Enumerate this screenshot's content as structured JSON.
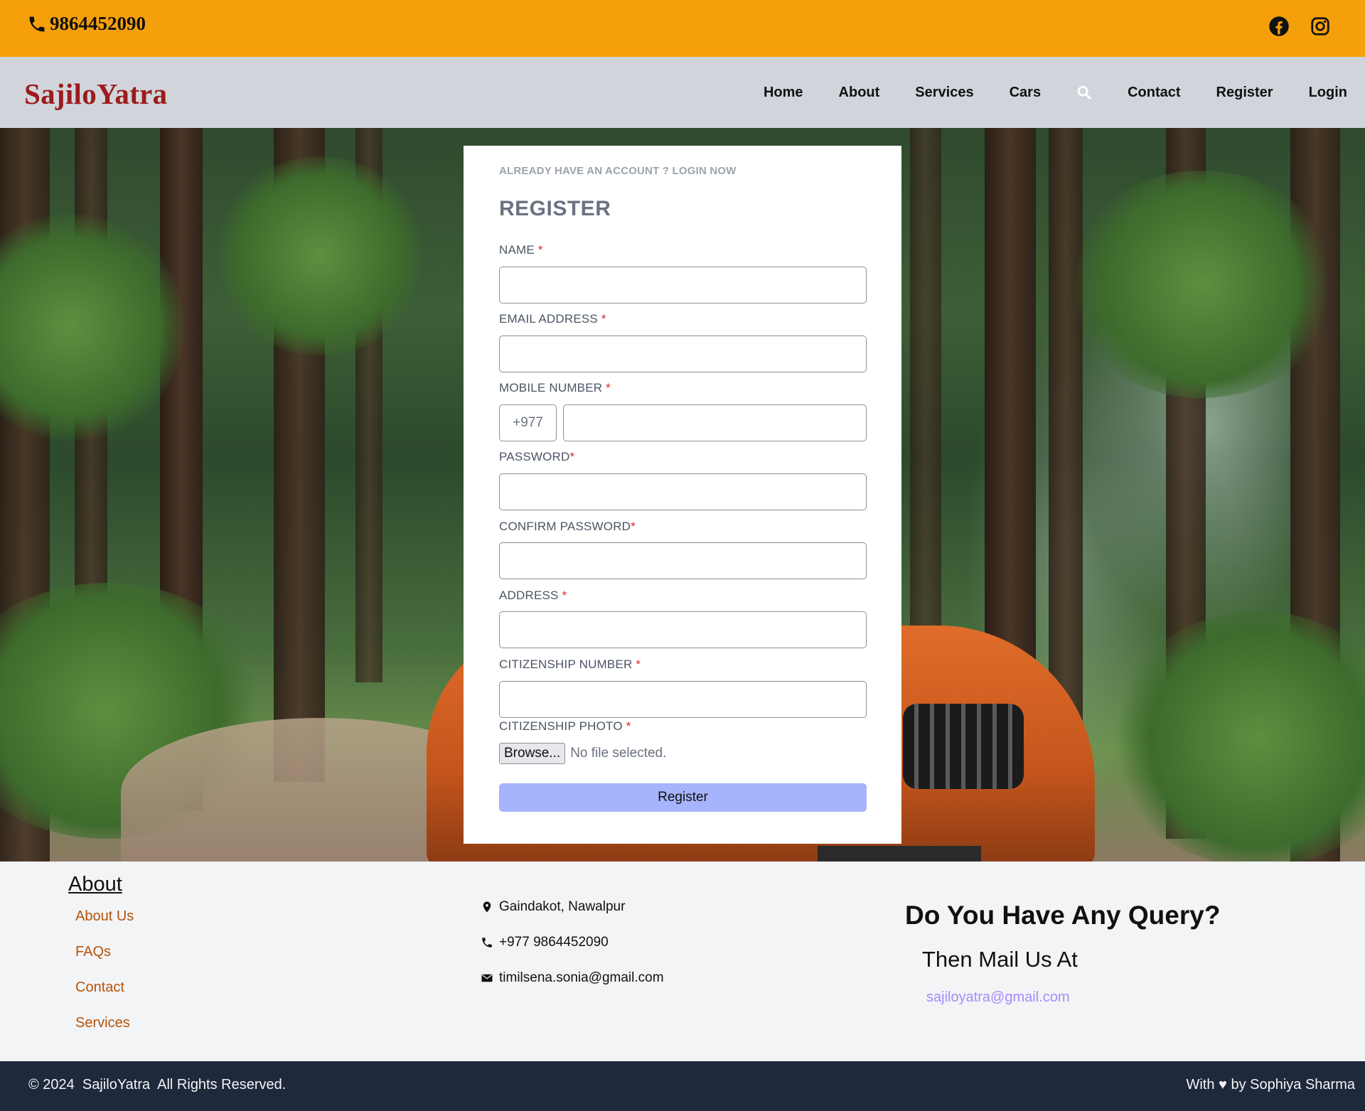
{
  "topbar": {
    "phone": "9864452090",
    "social_icons": [
      "facebook-icon",
      "instagram-icon"
    ],
    "bg_color": "#f5a00b"
  },
  "nav": {
    "brand": "SajiloYatra",
    "items": [
      "Home",
      "About",
      "Services",
      "Cars",
      "Contact",
      "Register",
      "Login"
    ],
    "search_icon": "search-icon",
    "brand_color": "#9b1c1c"
  },
  "form": {
    "already_text": "ALREADY HAVE AN ACCOUNT ? LOGIN NOW",
    "title": "REGISTER",
    "required_marker": "*",
    "fields": {
      "name_label": "NAME",
      "email_label": "EMAIL ADDRESS",
      "mobile_label": "MOBILE NUMBER",
      "country_code": "+977",
      "password_label": "PASSWORD",
      "confirm_password_label": "CONFIRM PASSWORD",
      "address_label": "ADDRESS",
      "citizenship_number_label": "CITIZENSHIP NUMBER",
      "citizenship_photo_label": "CITIZENSHIP PHOTO"
    },
    "browse_button": "Browse...",
    "no_file_text": "No file selected.",
    "submit_label": "Register",
    "submit_color": "#a5b4fc"
  },
  "footer": {
    "about_heading": "About",
    "about_links": [
      "About Us",
      "FAQs",
      "Contact",
      "Services"
    ],
    "contact": {
      "address": "Gaindakot, Nawalpur",
      "phone": "+977 9864452090",
      "email": "timilsena.sonia@gmail.com"
    },
    "query_heading": "Do You Have Any Query?",
    "then_text": "Then Mail Us At",
    "mail": "sajiloyatra@gmail.com",
    "link_color": "#b45309"
  },
  "bottom": {
    "copyright": "© 2024  SajiloYatra  All Rights Reserved.",
    "credit": "With ♥ by Sophiya Sharma",
    "bg_color": "#1e293b"
  }
}
